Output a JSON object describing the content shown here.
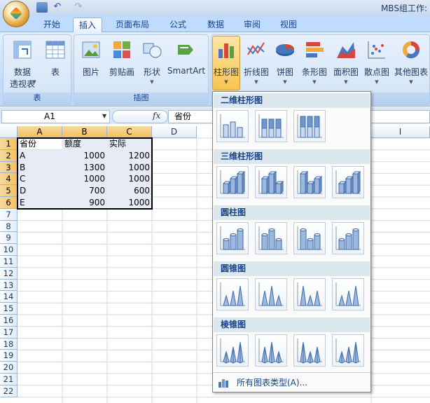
{
  "window": {
    "title": "MBS组工作:"
  },
  "tabs": [
    {
      "label": "开始"
    },
    {
      "label": "插入"
    },
    {
      "label": "页面布局"
    },
    {
      "label": "公式"
    },
    {
      "label": "数据"
    },
    {
      "label": "审阅"
    },
    {
      "label": "视图"
    }
  ],
  "ribbon": {
    "groups": {
      "tables": "表",
      "illustrations": "插图"
    },
    "buttons": {
      "pivot_line1": "数据",
      "pivot_line2": "透视表",
      "table": "表",
      "picture": "图片",
      "clipart": "剪贴画",
      "shapes": "形状",
      "smartart": "SmartArt",
      "column": "柱形图",
      "line": "折线图",
      "pie": "饼图",
      "bar": "条形图",
      "area": "面积图",
      "scatter": "散点图",
      "other": "其他图表"
    }
  },
  "formula_bar": {
    "name_box": "A1",
    "fx": "fx",
    "value": "省份"
  },
  "columns": [
    "A",
    "B",
    "C",
    "D",
    "I"
  ],
  "rows": [
    "1",
    "2",
    "3",
    "4",
    "5",
    "6",
    "7",
    "8",
    "9",
    "10",
    "11",
    "12",
    "13",
    "14",
    "15",
    "16",
    "17",
    "18",
    "19",
    "20",
    "21",
    "22"
  ],
  "table": {
    "header": [
      "省份",
      "额度",
      "实际"
    ],
    "rows": [
      [
        "A",
        "1000",
        "1200"
      ],
      [
        "B",
        "1300",
        "1000"
      ],
      [
        "C",
        "1000",
        "1000"
      ],
      [
        "D",
        "700",
        "600"
      ],
      [
        "E",
        "900",
        "1000"
      ]
    ]
  },
  "gallery": {
    "sections": [
      {
        "title": "二维柱形图"
      },
      {
        "title": "三维柱形图"
      },
      {
        "title": "圆柱图"
      },
      {
        "title": "圆锥图"
      },
      {
        "title": "棱锥图"
      }
    ],
    "all_types": "所有图表类型(A)..."
  },
  "colors": {
    "accent": "#15428b",
    "selection": "#f1c15f",
    "ribbon": "#c5dbf6"
  }
}
